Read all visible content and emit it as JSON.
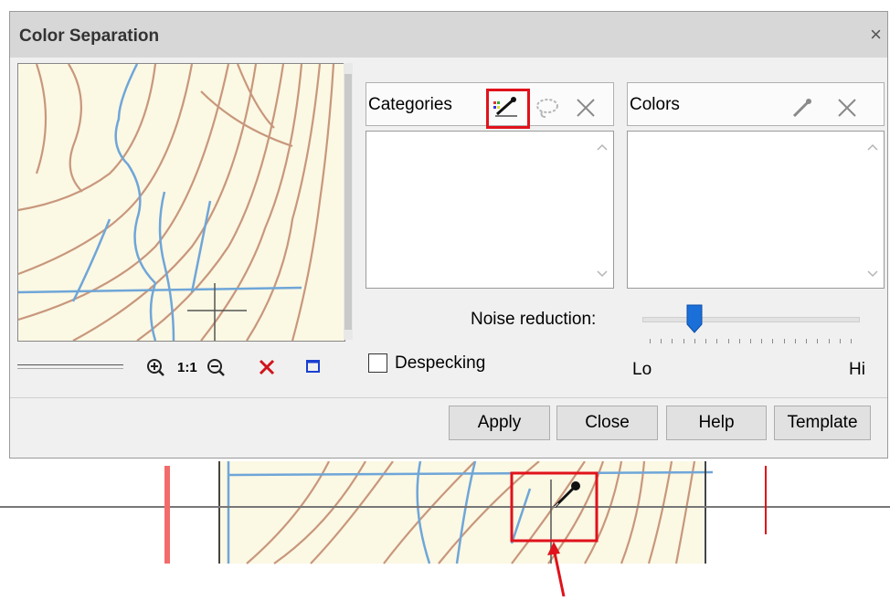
{
  "dialog": {
    "title": "Color Separation",
    "close_glyph": "×"
  },
  "zoom_toolbar": {
    "zoom_in_icon": "zoom-in-icon",
    "actual_size_label": "1:1",
    "zoom_out_icon": "zoom-out-icon",
    "clear_icon": "red-x-icon",
    "fit_icon": "frame-icon"
  },
  "categories": {
    "label": "Categories",
    "icons": [
      "eyedropper-edit-icon",
      "lasso-icon",
      "delete-x-icon"
    ]
  },
  "colors": {
    "label": "Colors",
    "icons": [
      "eyedropper-icon",
      "delete-x-icon"
    ]
  },
  "noise": {
    "label": "Noise reduction:",
    "lo": "Lo",
    "hi": "Hi",
    "level": 0.22
  },
  "despecking": {
    "label": "Despecking",
    "checked": false
  },
  "buttons": {
    "apply": "Apply",
    "close": "Close",
    "help": "Help",
    "template": "Template"
  },
  "accent_colors": {
    "highlight_red": "#e0121b",
    "slider_blue": "#1a6fd8",
    "map_background": "#fbf8e4",
    "contour_brown": "#c0876a",
    "stream_blue": "#6fa6d8"
  }
}
